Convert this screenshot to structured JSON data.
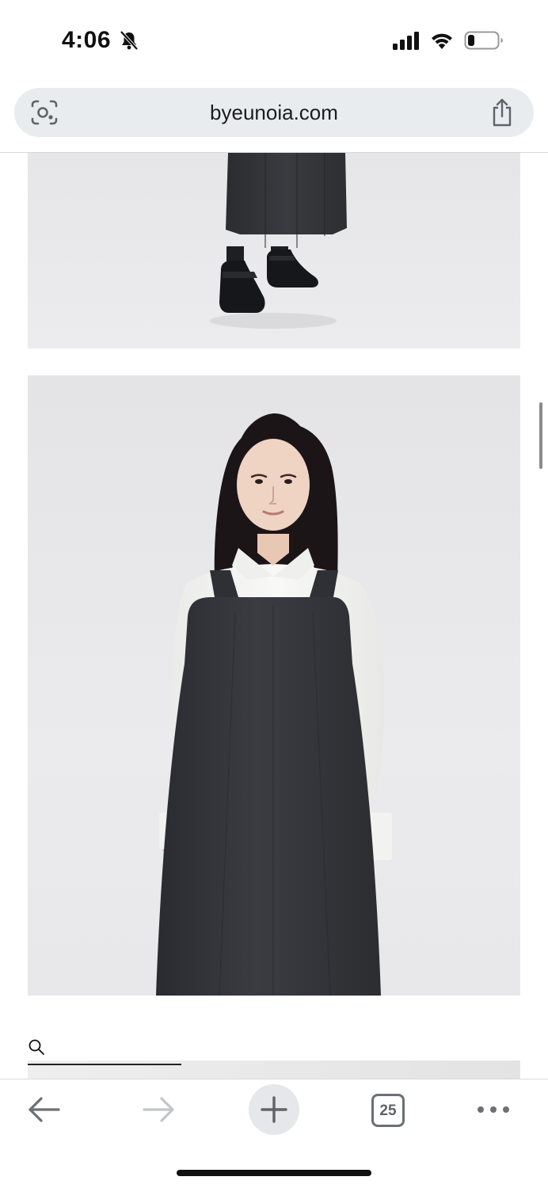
{
  "status_bar": {
    "time": "4:06",
    "icons": [
      "bell-slash-icon",
      "cellular-signal-icon",
      "wifi-icon",
      "battery-icon"
    ]
  },
  "browser": {
    "url": "byeunoia.com",
    "left_icon": "visual-search-icon",
    "right_icon": "share-icon"
  },
  "content": {
    "images": [
      {
        "name": "model-photo-feet",
        "description_icon": "image"
      },
      {
        "name": "model-photo-pinafore",
        "description_icon": "image"
      }
    ],
    "search_icon": "search-icon"
  },
  "toolbar": {
    "back_icon": "arrow-left-icon",
    "forward_icon": "arrow-right-icon",
    "new_tab_icon": "plus-icon",
    "tab_count": "25",
    "more_icon": "ellipsis-icon"
  },
  "colors": {
    "url_bar_bg": "#e9ecef",
    "pinafore": "#2f3034",
    "shirt": "#f6f6f4",
    "backdrop": "#e6e6e8"
  }
}
